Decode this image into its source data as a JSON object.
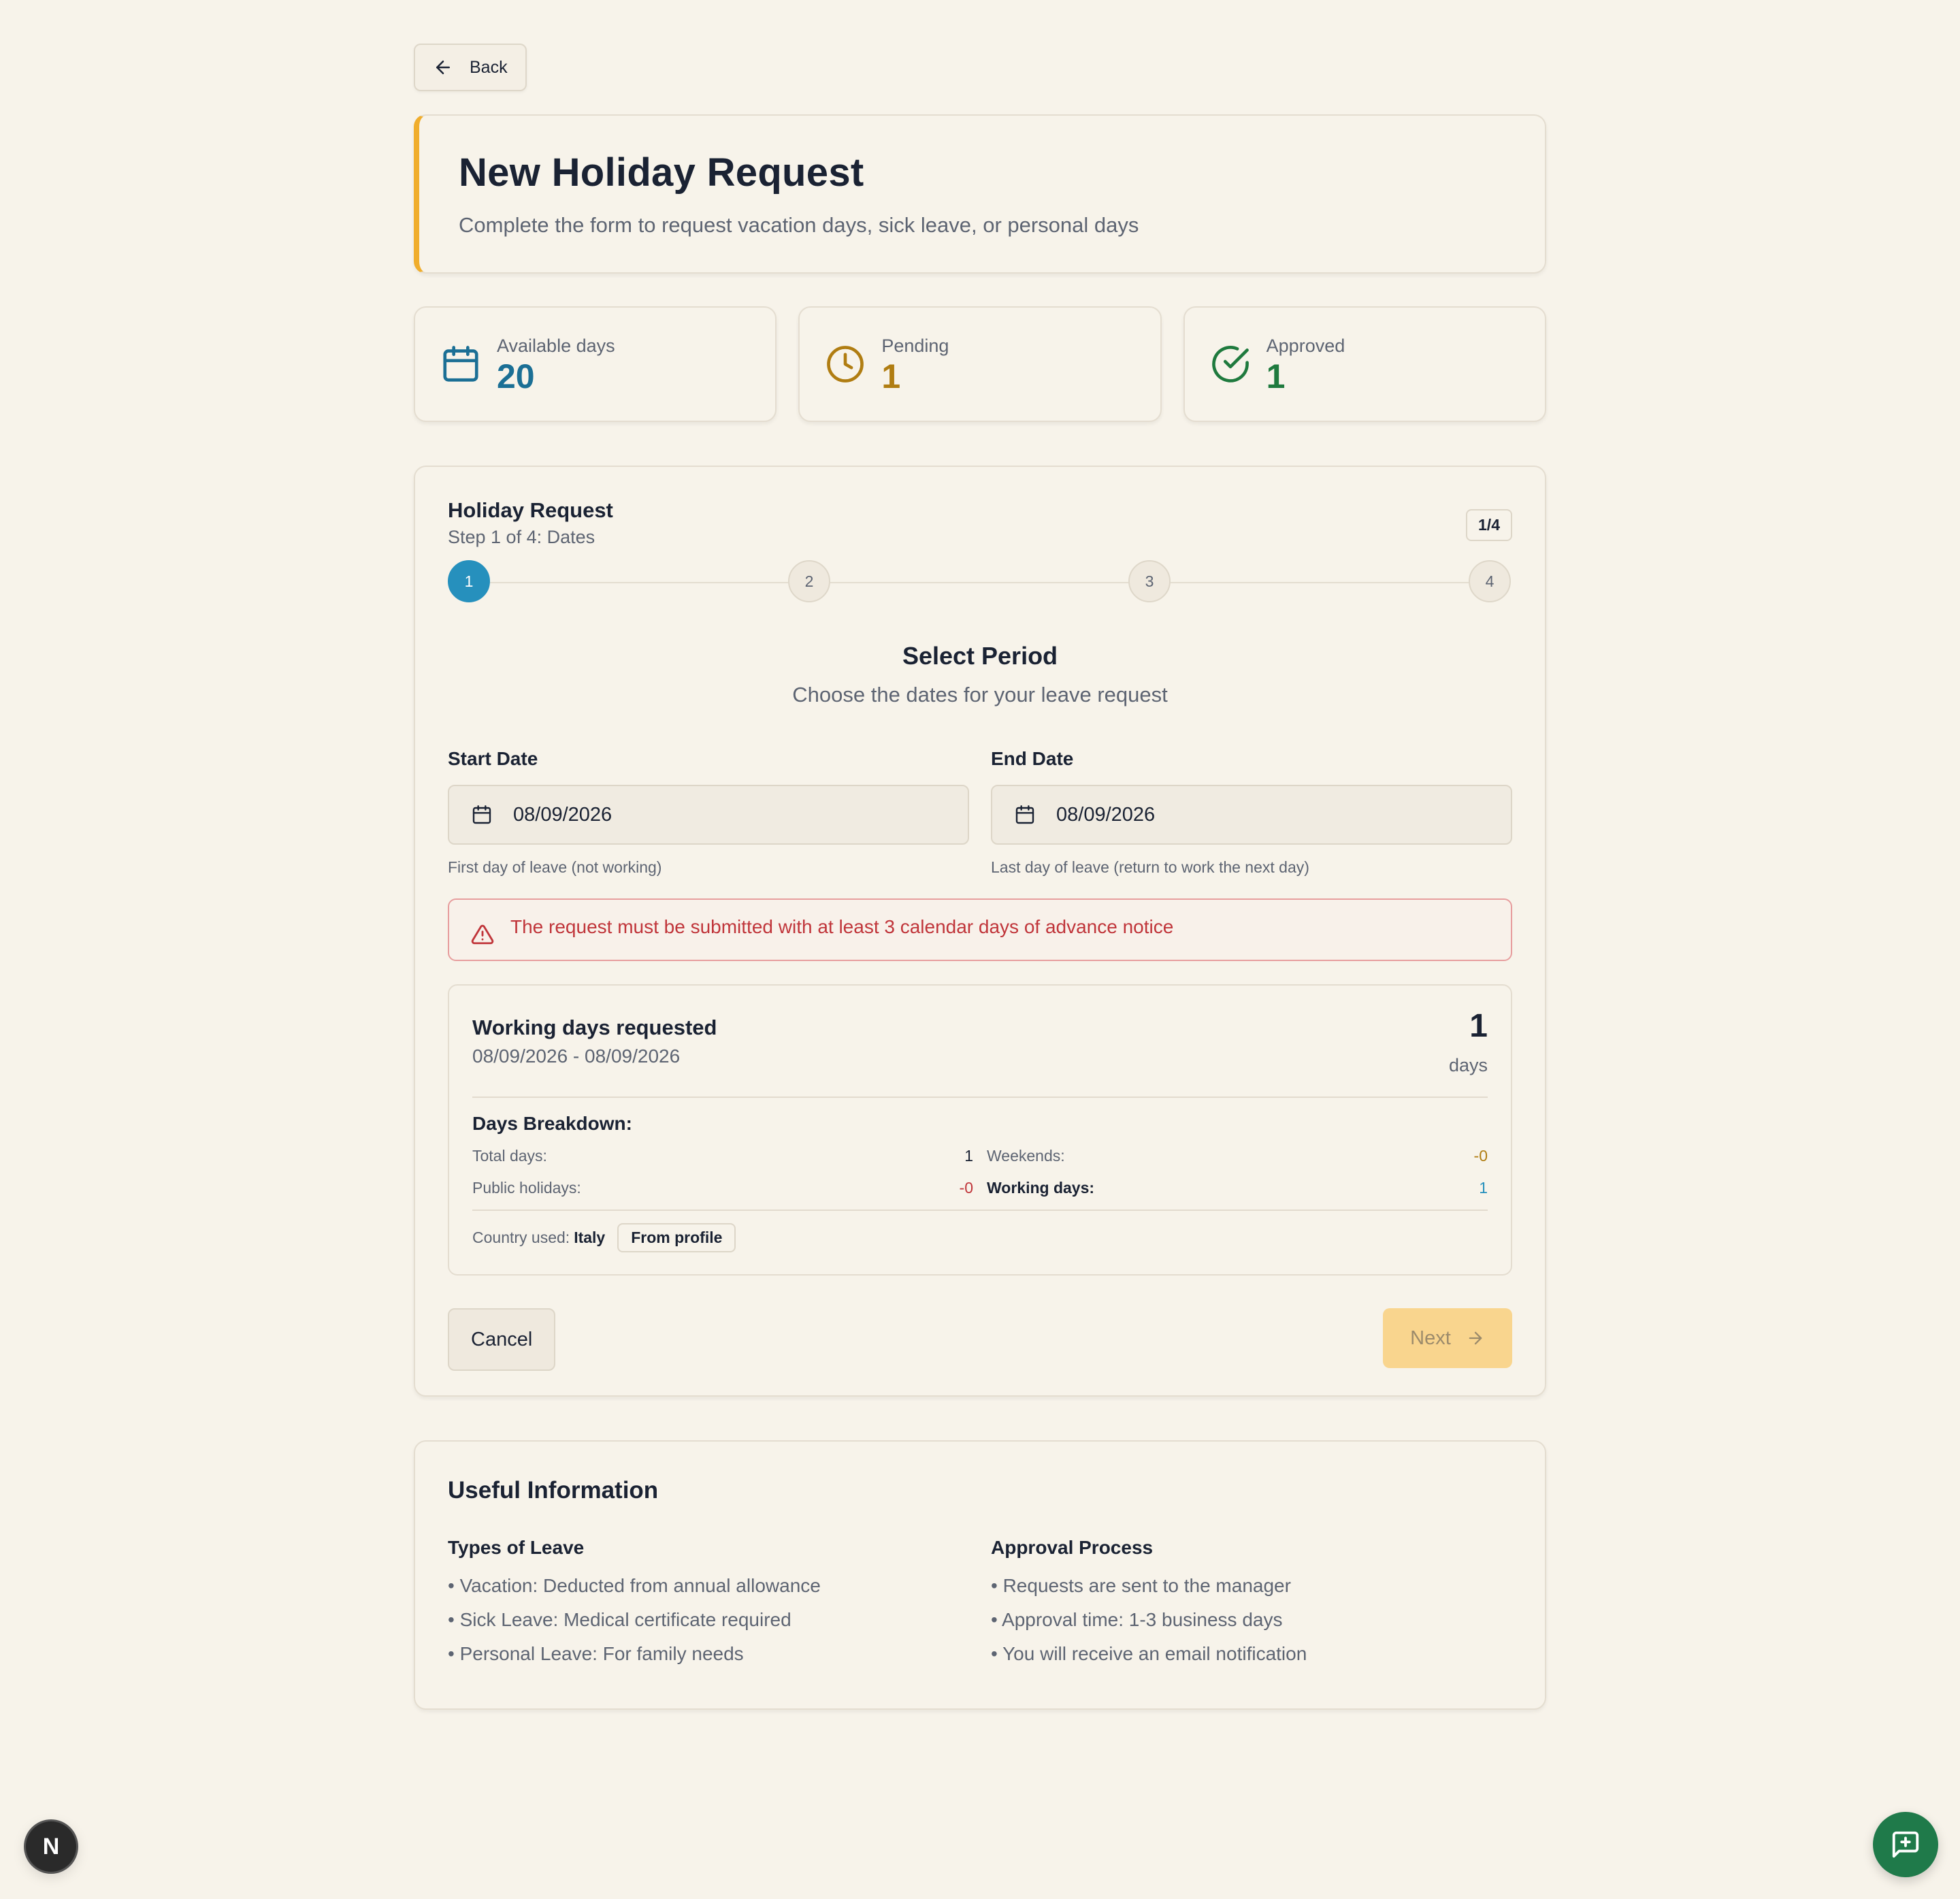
{
  "nav": {
    "back_label": "Back"
  },
  "header": {
    "title": "New Holiday Request",
    "subtitle": "Complete the form to request vacation days, sick leave, or personal days"
  },
  "stats": [
    {
      "label": "Available days",
      "value": "20",
      "icon": "calendar-icon",
      "color": "#1b6f95"
    },
    {
      "label": "Pending",
      "value": "1",
      "icon": "clock-icon",
      "color": "#b07d12"
    },
    {
      "label": "Approved",
      "value": "1",
      "icon": "check-circle-icon",
      "color": "#1f7a3e"
    }
  ],
  "form": {
    "title": "Holiday Request",
    "subtitle": "Step 1 of 4: Dates",
    "badge": "1/4",
    "steps": [
      "1",
      "2",
      "3",
      "4"
    ],
    "active_step": 1,
    "section_title": "Select Period",
    "section_subtitle": "Choose the dates for your leave request",
    "start_date": {
      "label": "Start Date",
      "value": "08/09/2026",
      "hint": "First day of leave (not working)"
    },
    "end_date": {
      "label": "End Date",
      "value": "08/09/2026",
      "hint": "Last day of leave (return to work the next day)"
    },
    "alert": "The request must be submitted with at least 3 calendar days of advance notice",
    "summary": {
      "title": "Working days requested",
      "range": "08/09/2026 - 08/09/2026",
      "count": "1",
      "unit": "days",
      "breakdown_title": "Days Breakdown:",
      "total_label": "Total days:",
      "total_value": "1",
      "weekends_label": "Weekends:",
      "weekends_value": "-0",
      "holidays_label": "Public holidays:",
      "holidays_value": "-0",
      "working_label": "Working days:",
      "working_value": "1",
      "country_label": "Country used:",
      "country_value": "Italy",
      "country_chip": "From profile"
    },
    "cancel_label": "Cancel",
    "next_label": "Next"
  },
  "info": {
    "title": "Useful Information",
    "types_title": "Types of Leave",
    "types": [
      "• Vacation: Deducted from annual allowance",
      "• Sick Leave: Medical certificate required",
      "• Personal Leave: For family needs"
    ],
    "approval_title": "Approval Process",
    "approval": [
      "• Requests are sent to the manager",
      "• Approval time: 1-3 business days",
      "• You will receive an email notification"
    ]
  },
  "dev_badge": "N",
  "colors": {
    "accent": "#f0ad2c",
    "primary": "#2690bd",
    "danger": "#c0353a",
    "fab": "#1f7a4a"
  }
}
